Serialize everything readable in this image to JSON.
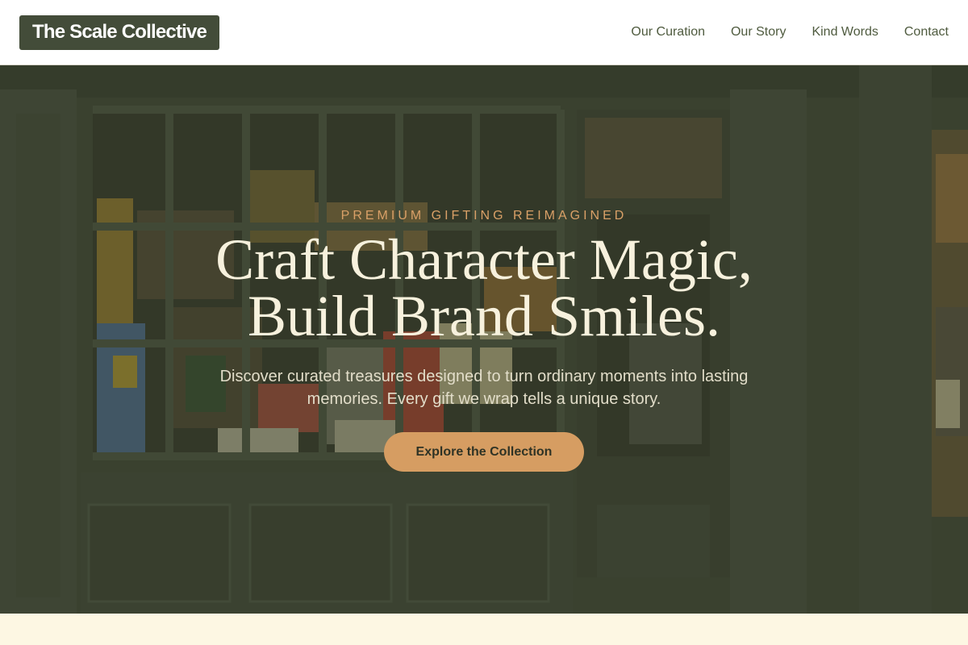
{
  "header": {
    "logo_text": "The Scale Collective",
    "nav": [
      {
        "label": "Our Curation"
      },
      {
        "label": "Our Story"
      },
      {
        "label": "Kind Words"
      },
      {
        "label": "Contact"
      }
    ]
  },
  "hero": {
    "eyebrow": "PREMIUM GIFTING REIMAGINED",
    "headline_line1": "Craft Character Magic,",
    "headline_line2": "Build Brand Smiles.",
    "subtext": "Discover curated treasures designed to turn ordinary moments into lasting memories. Every gift we wrap tells a unique story.",
    "cta_label": "Explore the Collection"
  },
  "colors": {
    "brand_dark": "#434c39",
    "nav_text": "#4f5b3f",
    "accent": "#d69d62",
    "eyebrow": "#d9a067",
    "headline": "#f7f1dd",
    "cream_bg": "#fdf7e3"
  }
}
